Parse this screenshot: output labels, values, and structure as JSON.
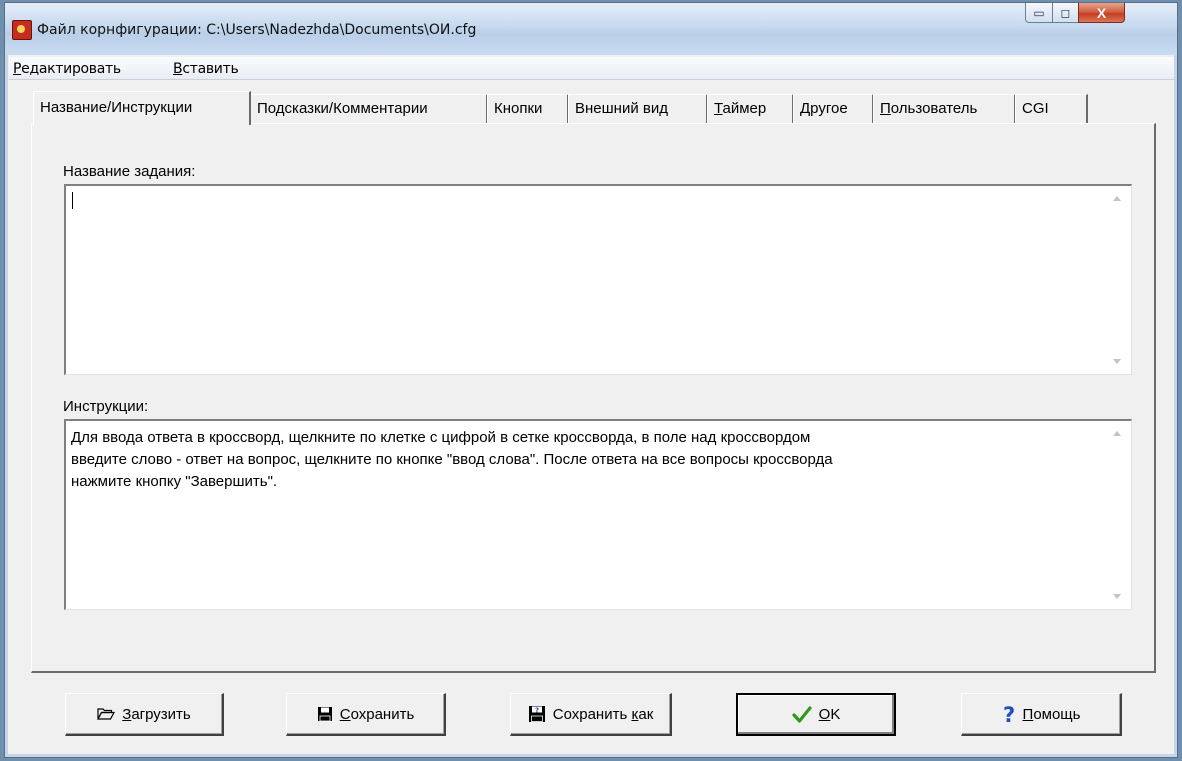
{
  "window": {
    "title": "Файл корнфигурации: C:\\Users\\Nadezhda\\Documents\\ОИ.cfg",
    "minimize_glyph": "▭",
    "maximize_glyph": "◻",
    "close_glyph": "X"
  },
  "menu": {
    "items": [
      {
        "label": "Редактировать",
        "mnemonic_index": 0
      },
      {
        "label": "Вставить",
        "mnemonic_index": 0
      }
    ]
  },
  "tabs": [
    {
      "label": "Название/Инструкции",
      "active": true
    },
    {
      "label": "Подсказки/Комментарии",
      "active": false
    },
    {
      "label": "Кнопки",
      "active": false
    },
    {
      "label": "Внешний вид",
      "active": false
    },
    {
      "label": "Таймер",
      "active": false
    },
    {
      "label": "Другое",
      "active": false
    },
    {
      "label": "Пользователь",
      "active": false
    },
    {
      "label": "CGI",
      "active": false
    }
  ],
  "form": {
    "title_label": "Название задания:",
    "title_value": "",
    "instructions_label": "Инструкции:",
    "instructions_value": "Для ввода ответа в кроссворд, щелкните по клетке с цифрой в сетке кроссворда, в поле над кроссвордом\nвведите слово - ответ на вопрос, щелкните по кнопке \"ввод слова\". После ответа на все вопросы кроссворда\nнажмите кнопку \"Завершить\"."
  },
  "buttons": {
    "load": {
      "pre": "",
      "mn": "З",
      "post": "агрузить",
      "icon": "folder-open-icon"
    },
    "save": {
      "pre": "",
      "mn": "С",
      "post": "охранить",
      "icon": "floppy-disk-icon"
    },
    "save_as": {
      "pre": "Сохранить ",
      "mn": "к",
      "post": "ак",
      "icon": "floppy-disk-question-icon"
    },
    "ok": {
      "pre": "",
      "mn": "O",
      "post": "K",
      "icon": "green-checkmark-icon"
    },
    "help": {
      "pre": "",
      "mn": "П",
      "post": "омощь",
      "icon": "blue-question-mark-icon"
    }
  },
  "colors": {
    "checkmark": "#2f9a1a",
    "help_question": "#1f4fbf",
    "close_button": "#c43c1f"
  }
}
